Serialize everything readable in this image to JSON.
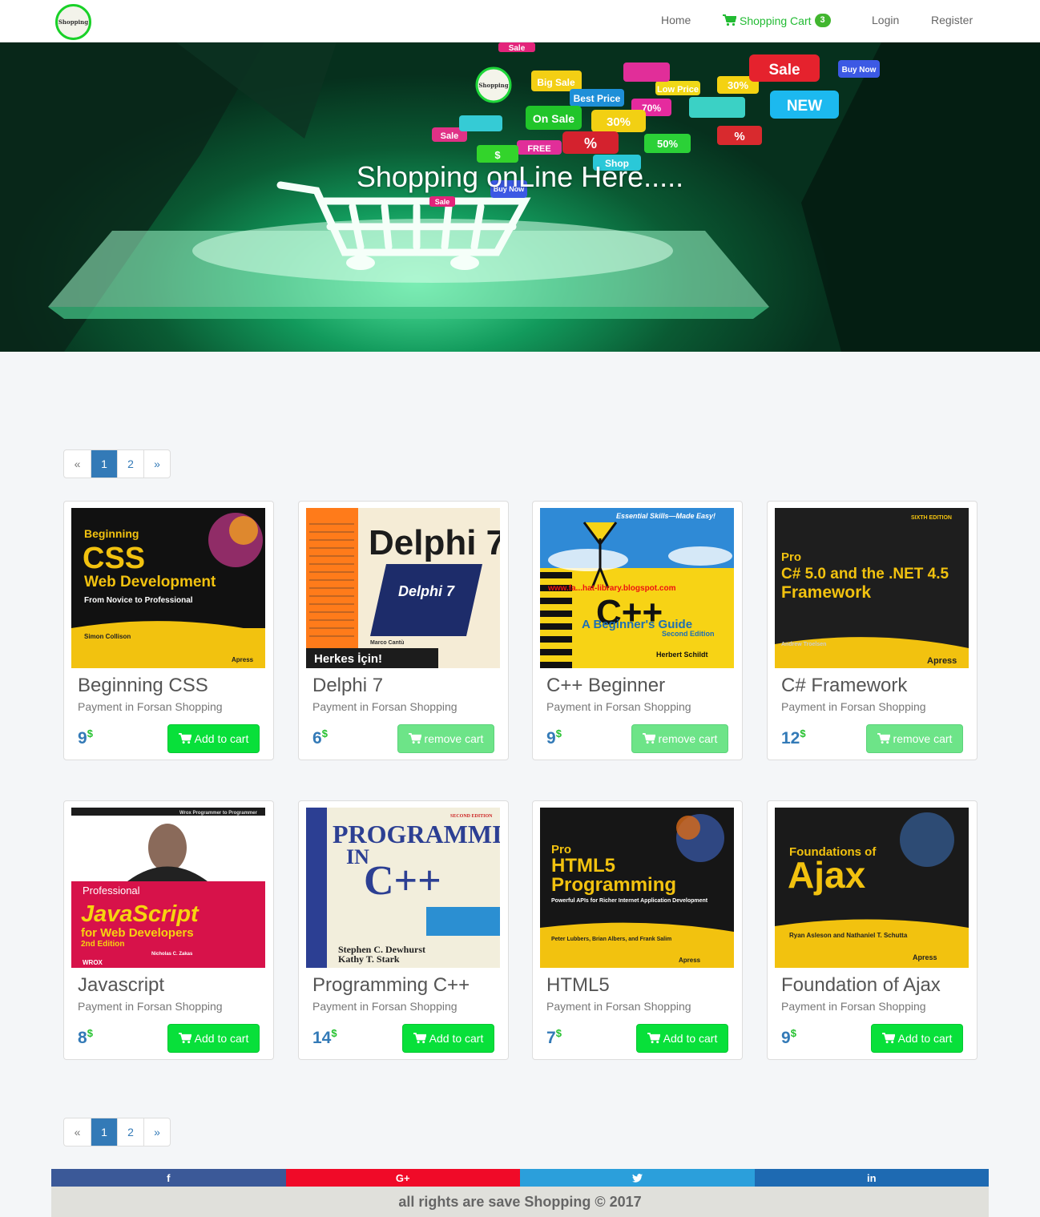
{
  "nav": {
    "logo_text": "Shopping",
    "home": "Home",
    "cart": "Shopping Cart",
    "cart_count": "3",
    "login": "Login",
    "register": "Register"
  },
  "hero": {
    "title": "Shopping onLine Here.....",
    "logo_text": "Shopping",
    "tags": [
      "Sale",
      "Big Sale",
      "Best Price",
      "Low Price",
      "30%",
      "Sale",
      "Buy Now",
      "On Sale",
      "70%",
      "30%",
      "NEW",
      "Sale",
      "%",
      "50%",
      "%",
      "FREE",
      "$",
      "Shop",
      "Buy Now",
      "Sale"
    ]
  },
  "pagination": {
    "prev": "«",
    "pages": [
      "1",
      "2"
    ],
    "active": "1",
    "next": "»"
  },
  "products": [
    {
      "title": "Beginning CSS",
      "subtitle": "Payment in Forsan Shopping",
      "price": "9",
      "currency": "$",
      "button": "Add to cart",
      "in_cart": false,
      "cover": {
        "lines": [
          "Beginning",
          "CSS",
          "Web Development",
          "From Novice to Professional",
          "Simon Collison",
          "Apress"
        ]
      }
    },
    {
      "title": "Delphi 7",
      "subtitle": "Payment in Forsan Shopping",
      "price": "6",
      "currency": "$",
      "button": "remove cart",
      "in_cart": true,
      "cover": {
        "lines": [
          "Delphi 7",
          "Delphi 7",
          "Herkes İçin!",
          "Marco Cantù"
        ]
      }
    },
    {
      "title": "C++ Beginner",
      "subtitle": "Payment in Forsan Shopping",
      "price": "9",
      "currency": "$",
      "button": "remove cart",
      "in_cart": true,
      "cover": {
        "lines": [
          "Essential Skills—Made Easy!",
          "www.fa...hat-library.blogspot.com",
          "C++",
          "A Beginner's Guide",
          "Second Edition",
          "Herbert Schildt"
        ]
      }
    },
    {
      "title": "C# Framework",
      "subtitle": "Payment in Forsan Shopping",
      "price": "12",
      "currency": "$",
      "button": "remove cart",
      "in_cart": true,
      "cover": {
        "lines": [
          "SIXTH EDITION",
          "Pro",
          "C# 5.0 and the .NET 4.5",
          "Framework",
          "Andrew Troelsen",
          "Apress"
        ]
      }
    },
    {
      "title": "Javascript",
      "subtitle": "Payment in Forsan Shopping",
      "price": "8",
      "currency": "$",
      "button": "Add to cart",
      "in_cart": false,
      "cover": {
        "lines": [
          "Wrox Programmer to Programmer",
          "Professional",
          "JavaScript",
          "for Web Developers",
          "2nd Edition",
          "Nicholas C. Zakas",
          "WROX"
        ]
      }
    },
    {
      "title": "Programming C++",
      "subtitle": "Payment in Forsan Shopping",
      "price": "14",
      "currency": "$",
      "button": "Add to cart",
      "in_cart": false,
      "cover": {
        "lines": [
          "SECOND EDITION",
          "PROGRAMMING",
          "IN",
          "C++",
          "Stephen C. Dewhurst",
          "Kathy T. Stark"
        ]
      }
    },
    {
      "title": "HTML5",
      "subtitle": "Payment in Forsan Shopping",
      "price": "7",
      "currency": "$",
      "button": "Add to cart",
      "in_cart": false,
      "cover": {
        "lines": [
          "Pro",
          "HTML5",
          "Programming",
          "Powerful APIs for Richer Internet Application Development",
          "Peter Lubbers, Brian Albers, and Frank Salim",
          "Apress"
        ]
      }
    },
    {
      "title": "Foundation of Ajax",
      "subtitle": "Payment in Forsan Shopping",
      "price": "9",
      "currency": "$",
      "button": "Add to cart",
      "in_cart": false,
      "cover": {
        "lines": [
          "Foundations of",
          "Ajax",
          "Ryan Asleson and Nathaniel T. Schutta",
          "Apress"
        ]
      }
    }
  ],
  "social": {
    "facebook": "f",
    "googleplus": "G+",
    "twitter": "twitter-icon",
    "linkedin": "in"
  },
  "footer": {
    "copyright": "all rights are save Shopping © 2017"
  },
  "colors": {
    "green_button": "#08e03a",
    "link_blue": "#337ab7",
    "hero_green": "#129a5c"
  }
}
